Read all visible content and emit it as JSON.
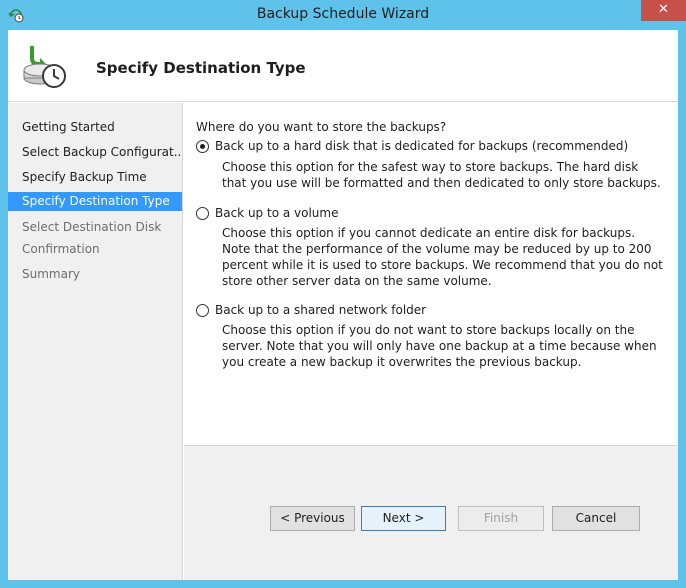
{
  "window": {
    "title": "Backup Schedule Wizard",
    "close_glyph": "✕"
  },
  "header": {
    "title": "Specify Destination Type",
    "icon": "backup-clock-icon"
  },
  "nav": {
    "items": [
      {
        "label": "Getting Started",
        "state": "done"
      },
      {
        "label": "Select Backup Configurat...",
        "state": "done"
      },
      {
        "label": "Specify Backup Time",
        "state": "done"
      },
      {
        "label": "Specify Destination Type",
        "state": "selected"
      },
      {
        "label": "Select Destination Disk",
        "state": "disabled"
      },
      {
        "label": "Confirmation",
        "state": "disabled"
      },
      {
        "label": "Summary",
        "state": "disabled"
      }
    ]
  },
  "main": {
    "question": "Where do you want to store the backups?",
    "options": [
      {
        "label": "Back up to a hard disk that is dedicated for backups (recommended)",
        "checked": true,
        "desc": "Choose this option for the safest way to store backups. The hard disk that you use will be formatted and then dedicated to only store backups."
      },
      {
        "label": "Back up to a volume",
        "checked": false,
        "desc": "Choose this option if you cannot dedicate an entire disk for backups. Note that the performance of the volume may be reduced by up to 200 percent while it is used to store backups. We recommend that you do not store other server data on the same volume."
      },
      {
        "label": "Back up to a shared network folder",
        "checked": false,
        "desc": "Choose this option if you do not want to store backups locally on the server. Note that you will only have one backup at a time because when you create a new backup it overwrites the previous backup."
      }
    ]
  },
  "buttons": {
    "previous": "< Previous",
    "next": "Next >",
    "finish": "Finish",
    "cancel": "Cancel"
  }
}
